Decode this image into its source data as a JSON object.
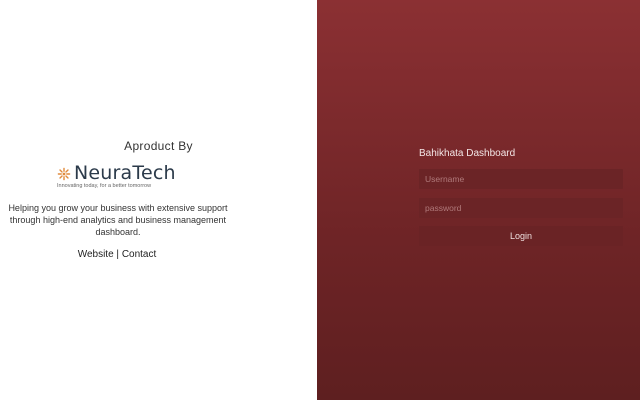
{
  "left_panel": {
    "tagline": "Aproduct By",
    "brand": {
      "name": "NeuraTech",
      "subtitle": "Innovating today, for a better tomorrow",
      "mark_icon": "sun-flower-icon",
      "mark_color": "#e08a3c"
    },
    "description": "Helping you grow your business with extensive support through high-end analytics and business management dashboard.",
    "links": {
      "website": "Website",
      "separator": " | ",
      "contact": "Contact"
    }
  },
  "right_panel": {
    "title": "Bahikhata Dashboard",
    "username_placeholder": "Username",
    "password_placeholder": "password",
    "login_label": "Login",
    "background_color": "#7d2a2d"
  }
}
